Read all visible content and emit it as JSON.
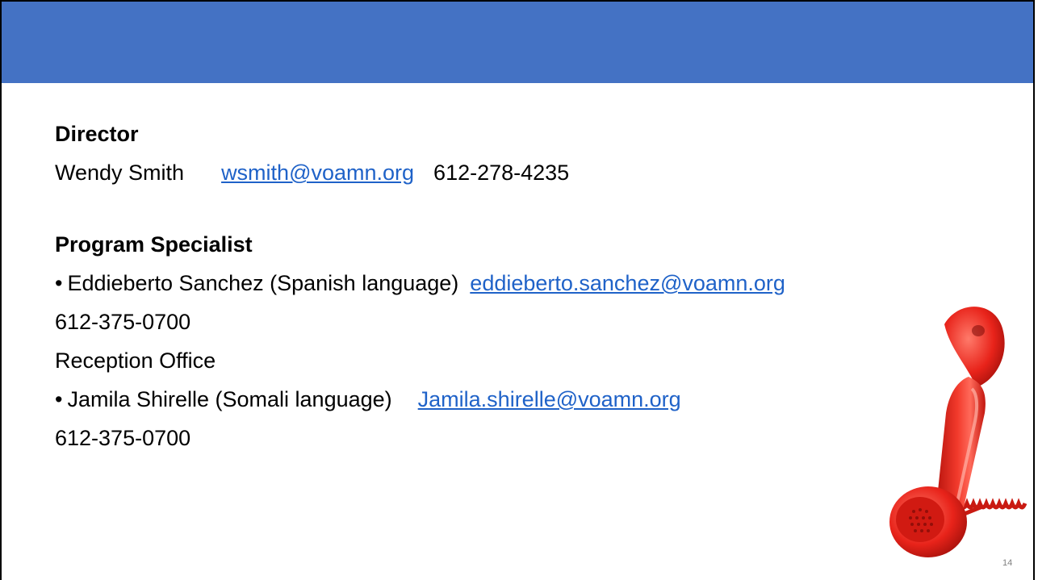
{
  "director": {
    "heading": "Director",
    "name": "Wendy Smith",
    "email": "wsmith@voamn.org",
    "phone": "612-278-4235"
  },
  "program_specialist": {
    "heading": "Program Specialist",
    "bullet": "•",
    "entries": [
      {
        "name": "Eddieberto Sanchez (Spanish language)",
        "email": "eddieberto.sanchez@voamn.org",
        "phone": "612-375-0700"
      },
      {
        "name": "Jamila Shirelle (Somali language)",
        "email": "Jamila.shirelle@voamn.org",
        "phone": "612-375-0700"
      }
    ],
    "reception_label": "Reception Office"
  },
  "page_number": "14",
  "colors": {
    "header_band": "#4472c4",
    "link": "#1f62c8",
    "phone_red": "#e8231a"
  },
  "icons": {
    "phone": "telephone-handset-icon"
  }
}
